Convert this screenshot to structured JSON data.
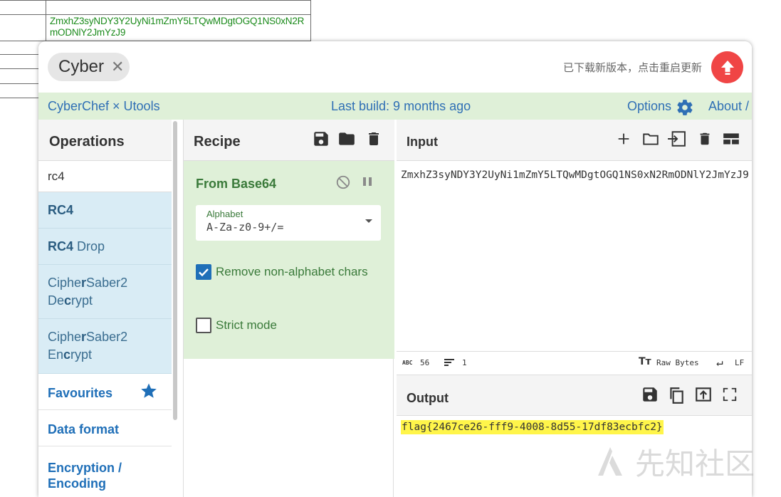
{
  "background_sheet": {
    "cell_text": "ZmxhZ3syNDY3Y2UyNi1mZmY5LTQwMDgtOGQ1NS0xN2RmODNlY2JmYzJ9"
  },
  "window": {
    "tab_label": "Cyber",
    "update_text": "已下载新版本，点击重启更新"
  },
  "banner": {
    "left": "CyberChef × Utools",
    "center": "Last build: 9 months ago",
    "options": "Options",
    "about": "About /"
  },
  "operations": {
    "title": "Operations",
    "search_value": "rc4",
    "results": [
      {
        "bold": "RC4",
        "rest": ""
      },
      {
        "bold": "RC4",
        "rest": " Drop"
      },
      {
        "line1_pre": "Ciphe",
        "line1_bold": "r",
        "line1_post": "Saber2",
        "line2_pre": "De",
        "line2_bold": "c",
        "line2_post": "rypt"
      },
      {
        "line1_pre": "Ciphe",
        "line1_bold": "r",
        "line1_post": "Saber2",
        "line2_pre": "En",
        "line2_bold": "c",
        "line2_post": "rypt"
      }
    ],
    "categories": [
      "Favourites",
      "Data format",
      "Encryption /",
      "Encoding"
    ]
  },
  "recipe": {
    "title": "Recipe",
    "operation": {
      "name": "From Base64",
      "alphabet_label": "Alphabet",
      "alphabet_value": "A-Za-z0-9+/=",
      "remove_non_alpha_label": "Remove non-alphabet chars",
      "remove_non_alpha_checked": true,
      "strict_mode_label": "Strict mode",
      "strict_mode_checked": false
    }
  },
  "input": {
    "title": "Input",
    "text": "ZmxhZ3syNDY3Y2UyNi1mZmY5LTQwMDgtOGQ1NS0xN2RmODNlY2JmYzJ9",
    "length": "56",
    "lines": "1",
    "encoding": "Raw Bytes",
    "eol": "LF"
  },
  "output": {
    "title": "Output",
    "text": "flag{2467ce26-fff9-4008-8d55-17df83ecbfc2}"
  },
  "watermark": "先知社区",
  "colors": {
    "banner_bg": "#dff0d8",
    "link_blue": "#2f6fb5",
    "op_green": "#3a7a3a",
    "update_red": "#f04545",
    "highlight": "#fff54a"
  }
}
